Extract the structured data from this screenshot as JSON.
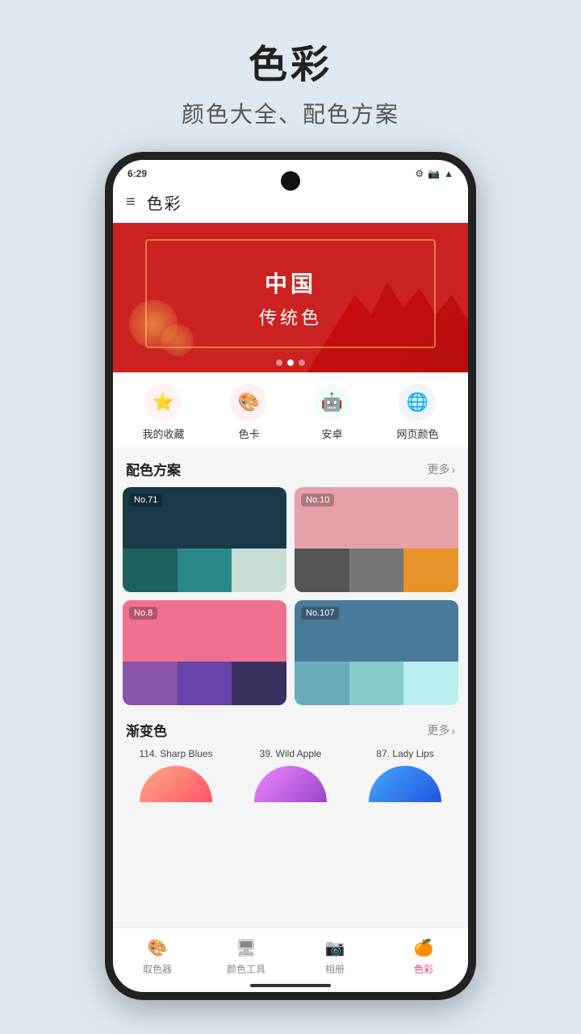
{
  "page": {
    "title": "色彩",
    "subtitle": "颜色大全、配色方案",
    "bg_color": "#dde8f0"
  },
  "status_bar": {
    "time": "6:29",
    "icons": [
      "⚙",
      "📷",
      "📶"
    ]
  },
  "app_bar": {
    "menu_icon": "≡",
    "title": "色彩"
  },
  "banner": {
    "line1": "中国",
    "line2": "传统色",
    "dots": [
      false,
      true,
      false
    ]
  },
  "quick_nav": {
    "items": [
      {
        "icon": "⭐",
        "label": "我的收藏",
        "color": "#ff6b6b"
      },
      {
        "icon": "🎨",
        "label": "色卡",
        "color": "#ff7979"
      },
      {
        "icon": "🤖",
        "label": "安卓",
        "color": "#3ddc84"
      },
      {
        "icon": "🌐",
        "label": "网页颜色",
        "color": "#4488ff"
      }
    ]
  },
  "palette_section": {
    "title": "配色方案",
    "more": "更多",
    "cards": [
      {
        "label": "No.71",
        "top_color": "#1a3a4a",
        "bottom_colors": [
          "#1f6060",
          "#2a8888",
          "#c8ded6"
        ]
      },
      {
        "label": "No.10",
        "top_color": "#e8a0a8",
        "bottom_colors": [
          "#555555",
          "#777777",
          "#e8922a"
        ]
      },
      {
        "label": "No.8",
        "top_color": "#f07090",
        "bottom_colors": [
          "#8855aa",
          "#6644aa",
          "#3a3060"
        ]
      },
      {
        "label": "No.107",
        "top_color": "#4a7a9a",
        "bottom_colors": [
          "#6aabbb",
          "#88cccc",
          "#bbeeee"
        ]
      }
    ]
  },
  "gradient_section": {
    "title": "渐变色",
    "more": "更多",
    "items": [
      {
        "name": "114. Sharp Blues",
        "color_start": "#ff8888",
        "color_end": "#ff5555"
      },
      {
        "name": "39. Wild Apple",
        "color_start": "#cc88ff",
        "color_end": "#9944cc"
      },
      {
        "name": "87. Lady Lips",
        "color_start": "#44aaff",
        "color_end": "#2266cc"
      }
    ]
  },
  "bottom_nav": {
    "items": [
      {
        "icon": "🎨",
        "label": "取色器",
        "active": false
      },
      {
        "icon": "🖥",
        "label": "颜色工具",
        "active": false
      },
      {
        "icon": "📷",
        "label": "相册",
        "active": false
      },
      {
        "icon": "🍊",
        "label": "色彩",
        "active": true
      }
    ]
  }
}
